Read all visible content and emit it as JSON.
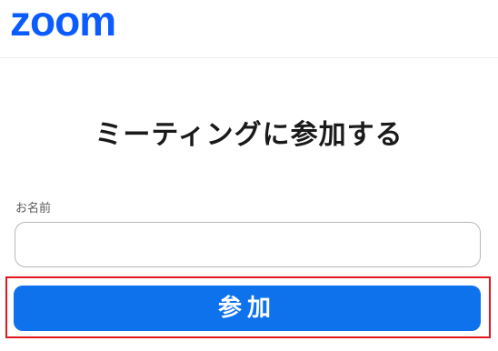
{
  "header": {
    "logo_text": "zoom"
  },
  "form": {
    "title": "ミーティングに参加する",
    "name_label": "お名前",
    "name_value": "",
    "join_label": "参加"
  },
  "colors": {
    "brand": "#0b5cff",
    "button": "#0e72ed",
    "highlight": "#e0181e"
  }
}
